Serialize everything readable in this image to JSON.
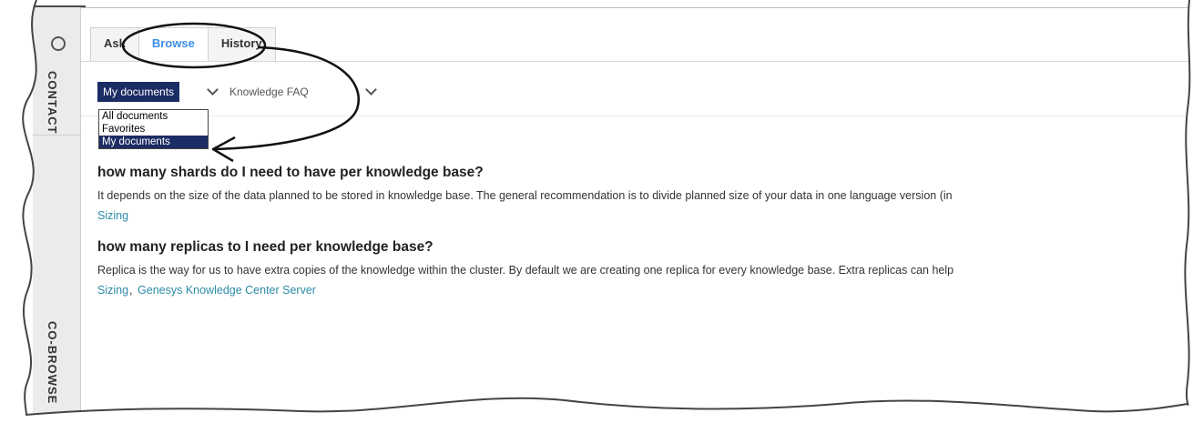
{
  "sidebar": {
    "contact_label": "CONTACT",
    "cobrowse_label": "CO-BROWSE",
    "top_icon": "info-icon"
  },
  "tabs": [
    {
      "label": "Ask",
      "active": false
    },
    {
      "label": "Browse",
      "active": true
    },
    {
      "label": "History",
      "active": false
    }
  ],
  "filters": {
    "scope_selected": "My documents",
    "knowledge_base": "Knowledge FAQ"
  },
  "scope_dropdown": {
    "options": [
      "All documents",
      "Favorites",
      "My documents"
    ],
    "selected": "My documents"
  },
  "results": [
    {
      "title": "how many shards do I need to have per knowledge base?",
      "body": "It depends on the size of the data planned to be stored in knowledge base. The general recommendation is to divide planned size of your data in one language version (in",
      "tags": [
        "Sizing"
      ]
    },
    {
      "title": "how many replicas to I need per knowledge base?",
      "body": "Replica is the way for us to have extra copies of the knowledge within the cluster. By default we are creating one replica for every knowledge base. Extra replicas can help",
      "tags": [
        "Sizing",
        "Genesys Knowledge Center Server"
      ]
    }
  ],
  "colors": {
    "accent": "#3a8ee6",
    "selected_bg": "#1c2c64",
    "link": "#2b8aa5",
    "sidebar_bg": "#ebebeb"
  }
}
